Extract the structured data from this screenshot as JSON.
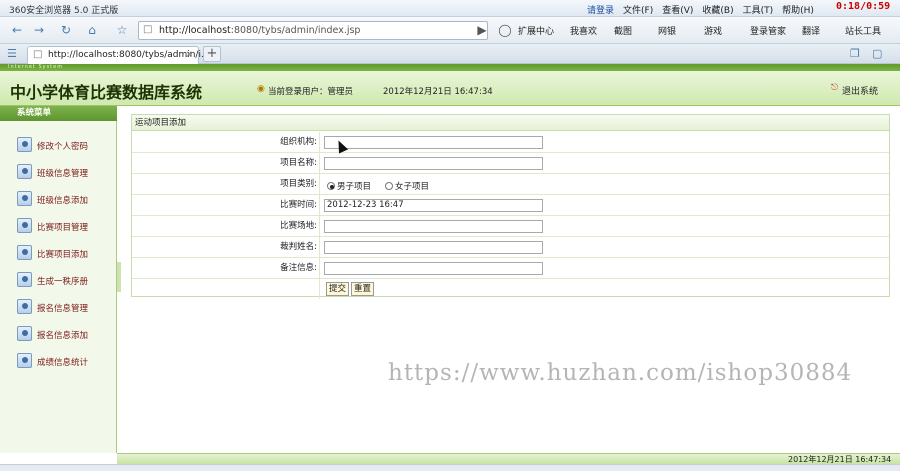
{
  "browser": {
    "title": "360安全浏览器 5.0 正式版",
    "login": "请登录",
    "menus": [
      "文件(F)",
      "查看(V)",
      "收藏(B)",
      "工具(T)",
      "帮助(H)"
    ],
    "clock": "0:18/0:59",
    "url_host": "http://localhost",
    "url_rest": ":8080/tybs/admin/index.jsp",
    "toolbar": [
      "扩展中心",
      "我喜欢",
      "截图",
      "网银",
      "游戏",
      "登录管家",
      "翻译",
      "站长工具"
    ],
    "tab_title": "http://localhost:8080/tybs/admin/i...",
    "new_tab": "+",
    "tab_close": "x"
  },
  "app": {
    "strip_text": "Internet System",
    "system_name": "中小学体育比赛数据库系统",
    "current_user": "当前登录用户：管理员",
    "datetime": "2012年12月21日  16:47:34",
    "logout": "退出系统"
  },
  "sidebar": {
    "title": "系统菜单",
    "items": [
      {
        "label": "修改个人密码"
      },
      {
        "label": "班级信息管理"
      },
      {
        "label": "班级信息添加"
      },
      {
        "label": "比赛项目管理"
      },
      {
        "label": "比赛项目添加"
      },
      {
        "label": "生成一秩序册"
      },
      {
        "label": "报名信息管理"
      },
      {
        "label": "报名信息添加"
      },
      {
        "label": "成绩信息统计"
      }
    ]
  },
  "form": {
    "title": "运动项目添加",
    "fields": {
      "org": {
        "label": "组织机构:",
        "value": ""
      },
      "name": {
        "label": "项目名称:",
        "value": ""
      },
      "category": {
        "label": "项目类别:",
        "option_male": "男子项目",
        "option_female": "女子项目",
        "selected": "男子项目"
      },
      "time": {
        "label": "比赛时间:",
        "value": "2012-12-23 16:47"
      },
      "venue": {
        "label": "比赛场地:",
        "value": ""
      },
      "judge": {
        "label": "裁判姓名:",
        "value": ""
      },
      "remark": {
        "label": "备注信息:",
        "value": ""
      }
    },
    "submit": "提交",
    "reset": "重置"
  },
  "footer": {
    "datetime": "2012年12月21日  16:47:34"
  },
  "watermark": "https://www.huzhan.com/ishop30884"
}
